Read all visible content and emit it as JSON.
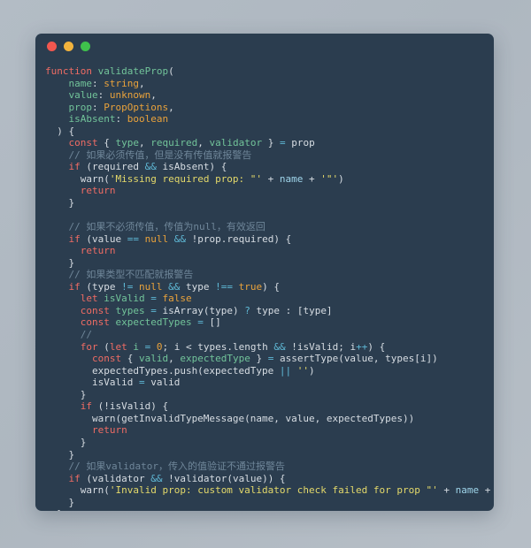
{
  "window": {
    "controls": [
      {
        "name": "close",
        "color": "#f2574f"
      },
      {
        "name": "minimize",
        "color": "#f2b33d"
      },
      {
        "name": "maximize",
        "color": "#3fc14c"
      }
    ],
    "background": "#2b3d4f",
    "page_background": "#b3bcc5"
  },
  "theme": {
    "keyword": "#ef6c64",
    "function": "#72c49a",
    "type": "#e9a23b",
    "string": "#e4d96a",
    "operator": "#5fb9d6",
    "comment": "#6f8699",
    "plain": "#d7dde3",
    "variable": "#9fd5ea"
  },
  "code": {
    "language": "typescript",
    "lines": [
      [
        {
          "t": "function ",
          "c": "kw"
        },
        {
          "t": "validateProp",
          "c": "fn"
        },
        {
          "t": "(",
          "c": "pl"
        }
      ],
      [
        {
          "t": "    ",
          "c": "pl"
        },
        {
          "t": "name",
          "c": "fn"
        },
        {
          "t": ": ",
          "c": "pl"
        },
        {
          "t": "string",
          "c": "typ"
        },
        {
          "t": ",",
          "c": "pl"
        }
      ],
      [
        {
          "t": "    ",
          "c": "pl"
        },
        {
          "t": "value",
          "c": "fn"
        },
        {
          "t": ": ",
          "c": "pl"
        },
        {
          "t": "unknown",
          "c": "typ"
        },
        {
          "t": ",",
          "c": "pl"
        }
      ],
      [
        {
          "t": "    ",
          "c": "pl"
        },
        {
          "t": "prop",
          "c": "fn"
        },
        {
          "t": ": ",
          "c": "pl"
        },
        {
          "t": "PropOptions",
          "c": "typ"
        },
        {
          "t": ",",
          "c": "pl"
        }
      ],
      [
        {
          "t": "    ",
          "c": "pl"
        },
        {
          "t": "isAbsent",
          "c": "fn"
        },
        {
          "t": ": ",
          "c": "pl"
        },
        {
          "t": "boolean",
          "c": "typ"
        }
      ],
      [
        {
          "t": "  ) {",
          "c": "pl"
        }
      ],
      [
        {
          "t": "    ",
          "c": "pl"
        },
        {
          "t": "const",
          "c": "kw"
        },
        {
          "t": " { ",
          "c": "pl"
        },
        {
          "t": "type",
          "c": "fn"
        },
        {
          "t": ", ",
          "c": "pl"
        },
        {
          "t": "required",
          "c": "fn"
        },
        {
          "t": ", ",
          "c": "pl"
        },
        {
          "t": "validator",
          "c": "fn"
        },
        {
          "t": " } ",
          "c": "pl"
        },
        {
          "t": "=",
          "c": "op"
        },
        {
          "t": " prop",
          "c": "pl"
        }
      ],
      [
        {
          "t": "    // 如果必须传值，但是没有传值就报警告",
          "c": "cmt"
        }
      ],
      [
        {
          "t": "    ",
          "c": "pl"
        },
        {
          "t": "if",
          "c": "kw"
        },
        {
          "t": " (required ",
          "c": "pl"
        },
        {
          "t": "&&",
          "c": "op"
        },
        {
          "t": " isAbsent) {",
          "c": "pl"
        }
      ],
      [
        {
          "t": "      warn(",
          "c": "pl"
        },
        {
          "t": "'Missing required prop: \"'",
          "c": "str"
        },
        {
          "t": " + ",
          "c": "pl"
        },
        {
          "t": "name",
          "c": "var"
        },
        {
          "t": " + ",
          "c": "pl"
        },
        {
          "t": "'\"'",
          "c": "str"
        },
        {
          "t": ")",
          "c": "pl"
        }
      ],
      [
        {
          "t": "      ",
          "c": "pl"
        },
        {
          "t": "return",
          "c": "kw"
        }
      ],
      [
        {
          "t": "    }",
          "c": "pl"
        }
      ],
      [
        {
          "t": "",
          "c": "pl"
        }
      ],
      [
        {
          "t": "    // 如果不必须传值，传值为null，有效返回",
          "c": "cmt"
        }
      ],
      [
        {
          "t": "    ",
          "c": "pl"
        },
        {
          "t": "if",
          "c": "kw"
        },
        {
          "t": " (value ",
          "c": "pl"
        },
        {
          "t": "==",
          "c": "op"
        },
        {
          "t": " ",
          "c": "pl"
        },
        {
          "t": "null",
          "c": "typ"
        },
        {
          "t": " ",
          "c": "pl"
        },
        {
          "t": "&&",
          "c": "op"
        },
        {
          "t": " !prop.required) {",
          "c": "pl"
        }
      ],
      [
        {
          "t": "      ",
          "c": "pl"
        },
        {
          "t": "return",
          "c": "kw"
        }
      ],
      [
        {
          "t": "    }",
          "c": "pl"
        }
      ],
      [
        {
          "t": "    // 如果类型不匹配就报警告",
          "c": "cmt"
        }
      ],
      [
        {
          "t": "    ",
          "c": "pl"
        },
        {
          "t": "if",
          "c": "kw"
        },
        {
          "t": " (type ",
          "c": "pl"
        },
        {
          "t": "!=",
          "c": "op"
        },
        {
          "t": " ",
          "c": "pl"
        },
        {
          "t": "null",
          "c": "typ"
        },
        {
          "t": " ",
          "c": "pl"
        },
        {
          "t": "&&",
          "c": "op"
        },
        {
          "t": " type ",
          "c": "pl"
        },
        {
          "t": "!==",
          "c": "op"
        },
        {
          "t": " ",
          "c": "pl"
        },
        {
          "t": "true",
          "c": "typ"
        },
        {
          "t": ") {",
          "c": "pl"
        }
      ],
      [
        {
          "t": "      ",
          "c": "pl"
        },
        {
          "t": "let",
          "c": "kw"
        },
        {
          "t": " ",
          "c": "pl"
        },
        {
          "t": "isValid",
          "c": "fn"
        },
        {
          "t": " ",
          "c": "pl"
        },
        {
          "t": "=",
          "c": "op"
        },
        {
          "t": " ",
          "c": "pl"
        },
        {
          "t": "false",
          "c": "typ"
        }
      ],
      [
        {
          "t": "      ",
          "c": "pl"
        },
        {
          "t": "const",
          "c": "kw"
        },
        {
          "t": " ",
          "c": "pl"
        },
        {
          "t": "types",
          "c": "fn"
        },
        {
          "t": " ",
          "c": "pl"
        },
        {
          "t": "=",
          "c": "op"
        },
        {
          "t": " isArray(type) ",
          "c": "pl"
        },
        {
          "t": "?",
          "c": "op"
        },
        {
          "t": " type : [type]",
          "c": "pl"
        }
      ],
      [
        {
          "t": "      ",
          "c": "pl"
        },
        {
          "t": "const",
          "c": "kw"
        },
        {
          "t": " ",
          "c": "pl"
        },
        {
          "t": "expectedTypes",
          "c": "fn"
        },
        {
          "t": " ",
          "c": "pl"
        },
        {
          "t": "=",
          "c": "op"
        },
        {
          "t": " []",
          "c": "pl"
        }
      ],
      [
        {
          "t": "      //",
          "c": "cmt"
        }
      ],
      [
        {
          "t": "      ",
          "c": "pl"
        },
        {
          "t": "for",
          "c": "kw"
        },
        {
          "t": " (",
          "c": "pl"
        },
        {
          "t": "let",
          "c": "kw"
        },
        {
          "t": " ",
          "c": "pl"
        },
        {
          "t": "i",
          "c": "fn"
        },
        {
          "t": " ",
          "c": "pl"
        },
        {
          "t": "=",
          "c": "op"
        },
        {
          "t": " ",
          "c": "pl"
        },
        {
          "t": "0",
          "c": "typ"
        },
        {
          "t": "; i < types.length ",
          "c": "pl"
        },
        {
          "t": "&&",
          "c": "op"
        },
        {
          "t": " !isValid; i",
          "c": "pl"
        },
        {
          "t": "++",
          "c": "op"
        },
        {
          "t": ") {",
          "c": "pl"
        }
      ],
      [
        {
          "t": "        ",
          "c": "pl"
        },
        {
          "t": "const",
          "c": "kw"
        },
        {
          "t": " { ",
          "c": "pl"
        },
        {
          "t": "valid",
          "c": "fn"
        },
        {
          "t": ", ",
          "c": "pl"
        },
        {
          "t": "expectedType",
          "c": "fn"
        },
        {
          "t": " } ",
          "c": "pl"
        },
        {
          "t": "=",
          "c": "op"
        },
        {
          "t": " assertType(value, types[i])",
          "c": "pl"
        }
      ],
      [
        {
          "t": "        expectedTypes.push(expectedType ",
          "c": "pl"
        },
        {
          "t": "||",
          "c": "op"
        },
        {
          "t": " ",
          "c": "pl"
        },
        {
          "t": "''",
          "c": "str"
        },
        {
          "t": ")",
          "c": "pl"
        }
      ],
      [
        {
          "t": "        isValid ",
          "c": "pl"
        },
        {
          "t": "=",
          "c": "op"
        },
        {
          "t": " valid",
          "c": "pl"
        }
      ],
      [
        {
          "t": "      }",
          "c": "pl"
        }
      ],
      [
        {
          "t": "      ",
          "c": "pl"
        },
        {
          "t": "if",
          "c": "kw"
        },
        {
          "t": " (!isValid) {",
          "c": "pl"
        }
      ],
      [
        {
          "t": "        warn(getInvalidTypeMessage(name, value, expectedTypes))",
          "c": "pl"
        }
      ],
      [
        {
          "t": "        ",
          "c": "pl"
        },
        {
          "t": "return",
          "c": "kw"
        }
      ],
      [
        {
          "t": "      }",
          "c": "pl"
        }
      ],
      [
        {
          "t": "    }",
          "c": "pl"
        }
      ],
      [
        {
          "t": "    // 如果validator，传入的值验证不通过报警告",
          "c": "cmt"
        }
      ],
      [
        {
          "t": "    ",
          "c": "pl"
        },
        {
          "t": "if",
          "c": "kw"
        },
        {
          "t": " (validator ",
          "c": "pl"
        },
        {
          "t": "&&",
          "c": "op"
        },
        {
          "t": " !validator(value)) {",
          "c": "pl"
        }
      ],
      [
        {
          "t": "      warn(",
          "c": "pl"
        },
        {
          "t": "'Invalid prop: custom validator check failed for prop \"'",
          "c": "str"
        },
        {
          "t": " + ",
          "c": "pl"
        },
        {
          "t": "name",
          "c": "var"
        },
        {
          "t": " + ",
          "c": "pl"
        },
        {
          "t": "'\".'",
          "c": "str"
        },
        {
          "t": ")",
          "c": "pl"
        }
      ],
      [
        {
          "t": "    }",
          "c": "pl"
        }
      ],
      [
        {
          "t": "  }",
          "c": "pl"
        }
      ]
    ]
  }
}
